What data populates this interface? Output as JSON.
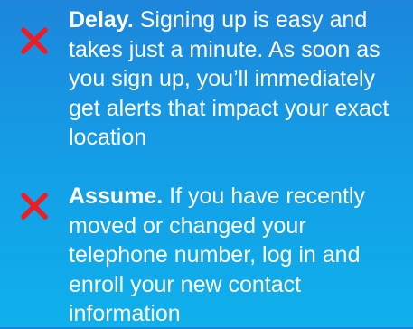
{
  "items": [
    {
      "icon": "red-x-icon",
      "bold": "Delay.",
      "text": " Signing up is easy and takes just a minute. As soon as you sign up, you’ll immediately get alerts that impact your exact location"
    },
    {
      "icon": "red-x-icon",
      "bold": "Assume.",
      "text": " If you have recently moved or changed your telephone number, log in and enroll your new contact information"
    }
  ],
  "colors": {
    "icon_red": "#ee1c25",
    "text": "#ffffff",
    "background_top": "#1d86db",
    "background_bottom": "#0fb0ec"
  }
}
